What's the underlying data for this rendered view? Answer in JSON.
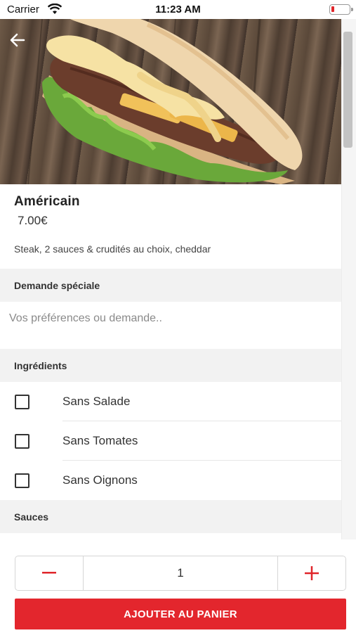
{
  "status_bar": {
    "carrier": "Carrier",
    "time": "11:23 AM",
    "wifi_icon": "wifi-icon",
    "battery_icon": "battery-icon",
    "battery_color": "#e0262b"
  },
  "header": {
    "back_icon": "arrow-left-icon"
  },
  "hero": {
    "image": "baguette-sandwich-photo"
  },
  "product": {
    "name": "Américain",
    "price": "7.00€",
    "description": "Steak, 2 sauces & crudités au choix, cheddar"
  },
  "special_request": {
    "title": "Demande spéciale",
    "placeholder": "Vos préférences ou demande.."
  },
  "ingredients": {
    "title": "Ingrédients",
    "items": [
      {
        "label": "Sans Salade",
        "checked": false
      },
      {
        "label": "Sans Tomates",
        "checked": false
      },
      {
        "label": "Sans Oignons",
        "checked": false
      }
    ]
  },
  "sauces": {
    "title": "Sauces"
  },
  "quantity": {
    "minus": "−",
    "value": "1",
    "plus": "+"
  },
  "cart_button": {
    "label": "AJOUTER AU PANIER"
  },
  "colors": {
    "accent": "#e3262d",
    "section_bg": "#f2f2f2"
  }
}
